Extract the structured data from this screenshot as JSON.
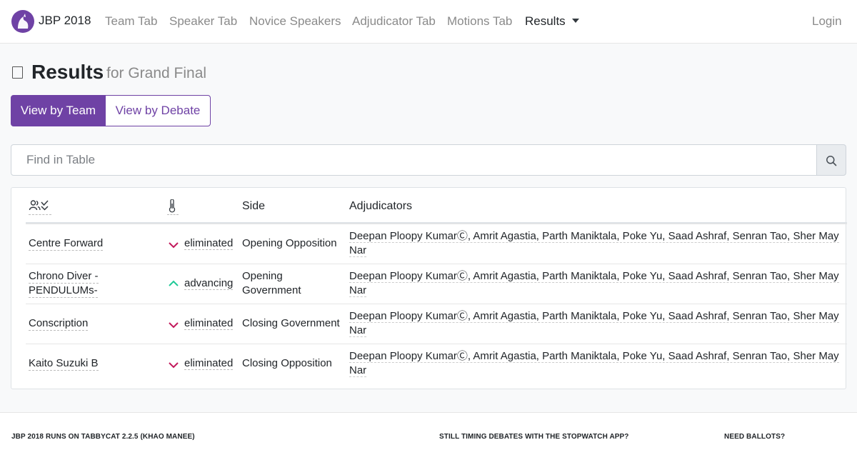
{
  "navbar": {
    "brand": "JBP 2018",
    "items": [
      "Team Tab",
      "Speaker Tab",
      "Novice Speakers",
      "Adjudicator Tab",
      "Motions Tab",
      "Results"
    ],
    "login": "Login"
  },
  "page": {
    "title": "Results",
    "subtitle": "for Grand Final"
  },
  "view_toggle": {
    "team": "View by Team",
    "debate": "View by Debate"
  },
  "search": {
    "placeholder": "Find in Table"
  },
  "table": {
    "headers": {
      "team_icon": "team-advancement-icon",
      "result_icon": "thermometer-icon",
      "side": "Side",
      "adjudicators": "Adjudicators"
    },
    "adjudicators_line1": "Deepan Ploopy KumarⒸ, Amrit Agastia, Parth Maniktala, Poke Yu, Saad Ashraf, Senran Tao, Sher May",
    "adjudicators_line2": "Nar",
    "rows": [
      {
        "team": "Centre Forward",
        "team2": "",
        "result": "eliminated",
        "side": "Opening Opposition",
        "side2": ""
      },
      {
        "team": "Chrono Diver -",
        "team2": "PENDULUMs-",
        "result": "advancing",
        "side": "Opening",
        "side2": "Government"
      },
      {
        "team": "Conscription",
        "team2": "",
        "result": "eliminated",
        "side": "Closing Government",
        "side2": ""
      },
      {
        "team": "Kaito Suzuki B",
        "team2": "",
        "result": "eliminated",
        "side": "Closing Opposition",
        "side2": ""
      }
    ],
    "colors": {
      "eliminated": "#c2185b",
      "advancing": "#20c997"
    }
  },
  "footer": {
    "left": "JBP 2018 RUNS ON TABBYCAT 2.2.5 (KHAO MANEE)",
    "middle": "STILL TIMING DEBATES WITH THE STOPWATCH APP?",
    "right": "NEED BALLOTS?"
  }
}
